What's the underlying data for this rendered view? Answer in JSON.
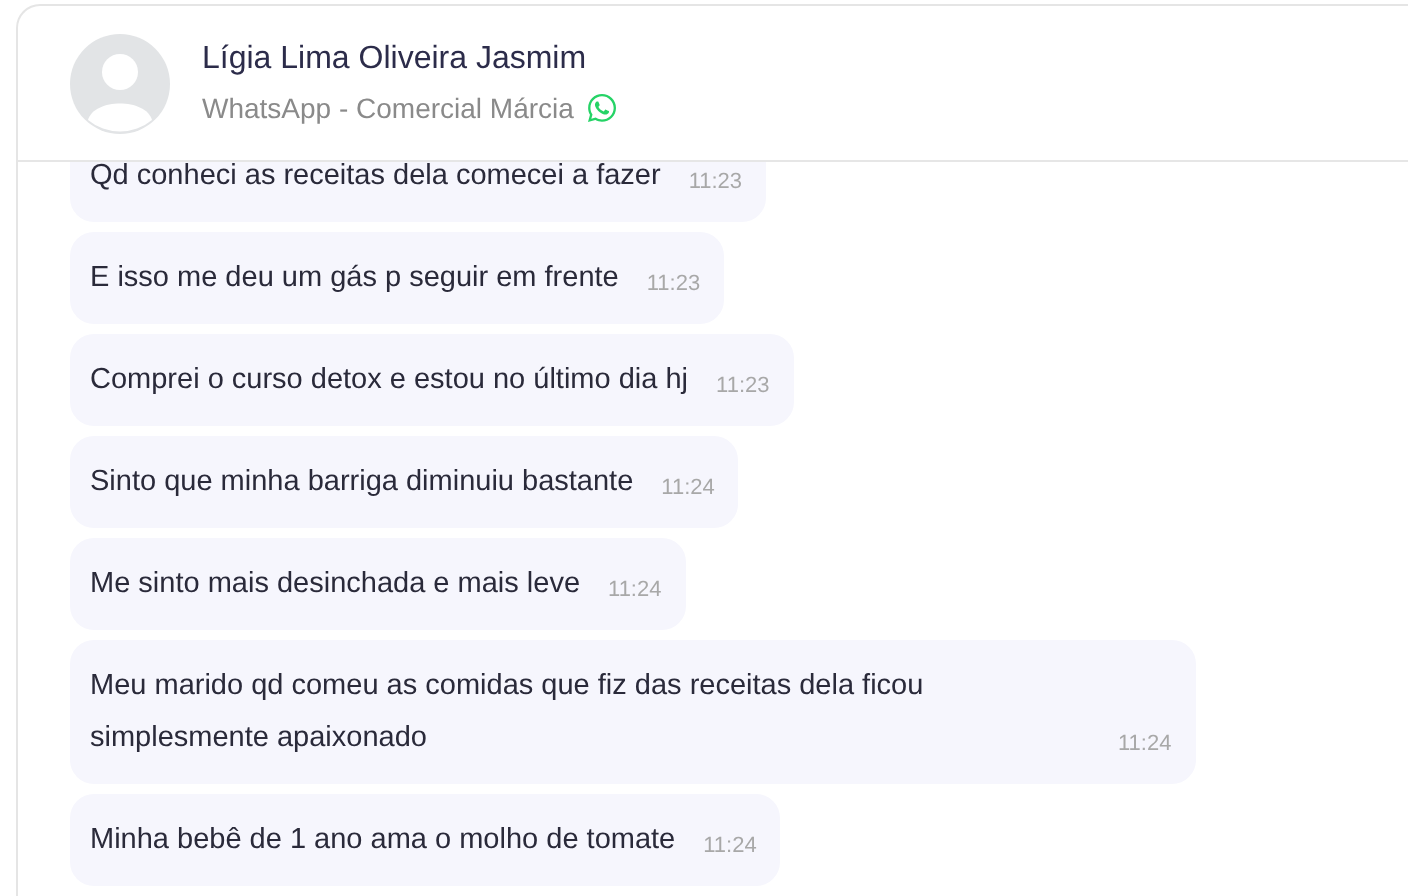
{
  "contact": {
    "name": "Lígia Lima Oliveira Jasmim",
    "channel": "WhatsApp - Comercial Márcia"
  },
  "messages": [
    {
      "text": "Qd conheci as receitas dela comecei a fazer",
      "time": "11:23"
    },
    {
      "text": "E isso me deu um gás p seguir em frente",
      "time": "11:23"
    },
    {
      "text": "Comprei o curso detox e estou no último dia hj",
      "time": "11:23"
    },
    {
      "text": "Sinto que minha barriga diminuiu bastante",
      "time": "11:24"
    },
    {
      "text": "Me sinto mais desinchada e mais leve",
      "time": "11:24"
    },
    {
      "text": "Meu marido qd comeu as comidas que fiz das receitas dela ficou simplesmente apaixonado",
      "time": "11:24"
    },
    {
      "text": "Minha bebê de 1 ano ama o molho de tomate",
      "time": "11:24"
    }
  ]
}
